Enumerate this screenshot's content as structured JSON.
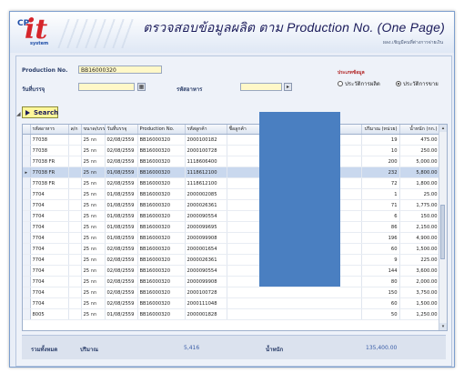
{
  "header": {
    "logo_cp": "CP",
    "logo_it": "it",
    "logo_sub": "system",
    "title": "ตรวจสอบข้อมูลผลิต ตาม Production No. (One Page)",
    "subtitle": "ผลง.เชิญมีคนที่ต่างการจ่ายเงิน"
  },
  "form": {
    "production_label": "Production No.",
    "production_value": "BB16000320",
    "date_label": "วันที่บรรจุ",
    "date_value": "",
    "product_code_label": "รหัสอาหาร",
    "product_code_value": "",
    "radio_title": "ประเภทข้อมูล",
    "radio_options": [
      {
        "label": "ประวัติการผลิต",
        "checked": false
      },
      {
        "label": "ประวัติการขาย",
        "checked": true
      }
    ],
    "search_label": "Search"
  },
  "grid": {
    "columns": [
      "รหัสอาหาร",
      "ล/ก",
      "ขนาด/บรรจุ",
      "วันที่บรรจุ",
      "Production No.",
      "รหัสลูกค้า",
      "ชื่อลูกค้า",
      "ปริมาณ (หน่วย)",
      "น้ำหนัก (กก.)"
    ],
    "rows": [
      {
        "code": "77038",
        "lot": "",
        "size": "25 กก",
        "date": "02/08/2559",
        "prod": "BB16000320",
        "cust": "2000100182",
        "name": "",
        "qty": "19",
        "weight": "475.00"
      },
      {
        "code": "77038",
        "lot": "",
        "size": "25 กก",
        "date": "02/08/2559",
        "prod": "BB16000320",
        "cust": "2000100728",
        "name": "",
        "qty": "10",
        "weight": "250.00"
      },
      {
        "code": "77038 FR",
        "lot": "",
        "size": "25 กก",
        "date": "02/08/2559",
        "prod": "BB16000320",
        "cust": "1118606400",
        "name": "",
        "qty": "200",
        "weight": "5,000.00"
      },
      {
        "code": "77038 FR",
        "lot": "",
        "size": "25 กก",
        "date": "01/08/2559",
        "prod": "BB16000320",
        "cust": "1118612100",
        "name": "",
        "qty": "232",
        "weight": "5,800.00"
      },
      {
        "code": "77038 FR",
        "lot": "",
        "size": "25 กก",
        "date": "02/08/2559",
        "prod": "BB16000320",
        "cust": "1118612100",
        "name": "",
        "qty": "72",
        "weight": "1,800.00"
      },
      {
        "code": "7704",
        "lot": "",
        "size": "25 กก",
        "date": "01/08/2559",
        "prod": "BB16000320",
        "cust": "2000002085",
        "name": "",
        "qty": "1",
        "weight": "25.00"
      },
      {
        "code": "7704",
        "lot": "",
        "size": "25 กก",
        "date": "01/08/2559",
        "prod": "BB16000320",
        "cust": "2000026361",
        "name": "",
        "qty": "71",
        "weight": "1,775.00"
      },
      {
        "code": "7704",
        "lot": "",
        "size": "25 กก",
        "date": "01/08/2559",
        "prod": "BB16000320",
        "cust": "2000090554",
        "name": "",
        "qty": "6",
        "weight": "150.00"
      },
      {
        "code": "7704",
        "lot": "",
        "size": "25 กก",
        "date": "01/08/2559",
        "prod": "BB16000320",
        "cust": "2000099695",
        "name": "",
        "qty": "86",
        "weight": "2,150.00"
      },
      {
        "code": "7704",
        "lot": "",
        "size": "25 กก",
        "date": "01/08/2559",
        "prod": "BB16000320",
        "cust": "2000099908",
        "name": "",
        "qty": "196",
        "weight": "4,900.00"
      },
      {
        "code": "7704",
        "lot": "",
        "size": "25 กก",
        "date": "02/08/2559",
        "prod": "BB16000320",
        "cust": "2000001654",
        "name": "",
        "qty": "60",
        "weight": "1,500.00"
      },
      {
        "code": "7704",
        "lot": "",
        "size": "25 กก",
        "date": "02/08/2559",
        "prod": "BB16000320",
        "cust": "2000026361",
        "name": "",
        "qty": "9",
        "weight": "225.00"
      },
      {
        "code": "7704",
        "lot": "",
        "size": "25 กก",
        "date": "02/08/2559",
        "prod": "BB16000320",
        "cust": "2000090554",
        "name": "",
        "qty": "144",
        "weight": "3,600.00"
      },
      {
        "code": "7704",
        "lot": "",
        "size": "25 กก",
        "date": "02/08/2559",
        "prod": "BB16000320",
        "cust": "2000099908",
        "name": "",
        "qty": "80",
        "weight": "2,000.00"
      },
      {
        "code": "7704",
        "lot": "",
        "size": "25 กก",
        "date": "02/08/2559",
        "prod": "BB16000320",
        "cust": "2000100728",
        "name": "",
        "qty": "150",
        "weight": "3,750.00"
      },
      {
        "code": "7704",
        "lot": "",
        "size": "25 กก",
        "date": "02/08/2559",
        "prod": "BB16000320",
        "cust": "2000111048",
        "name": "",
        "qty": "60",
        "weight": "1,500.00"
      },
      {
        "code": "8005",
        "lot": "",
        "size": "25 กก",
        "date": "01/08/2559",
        "prod": "BB16000320",
        "cust": "2000001828",
        "name": "",
        "qty": "50",
        "weight": "1,250.00"
      }
    ],
    "selected_row_index": 3
  },
  "footer": {
    "total_label": "รวมทั้งหมด",
    "qty_label": "ปริมาณ",
    "qty_value": "5,416",
    "weight_label": "น้ำหนัก",
    "weight_value": "135,400.00"
  },
  "colors": {
    "title_text": "#1b1b5a",
    "field_bg": "#fff8c8",
    "selected_row": "#c9d8ee",
    "redaction": "#4a7fc1",
    "logo_red": "#d6262b"
  }
}
